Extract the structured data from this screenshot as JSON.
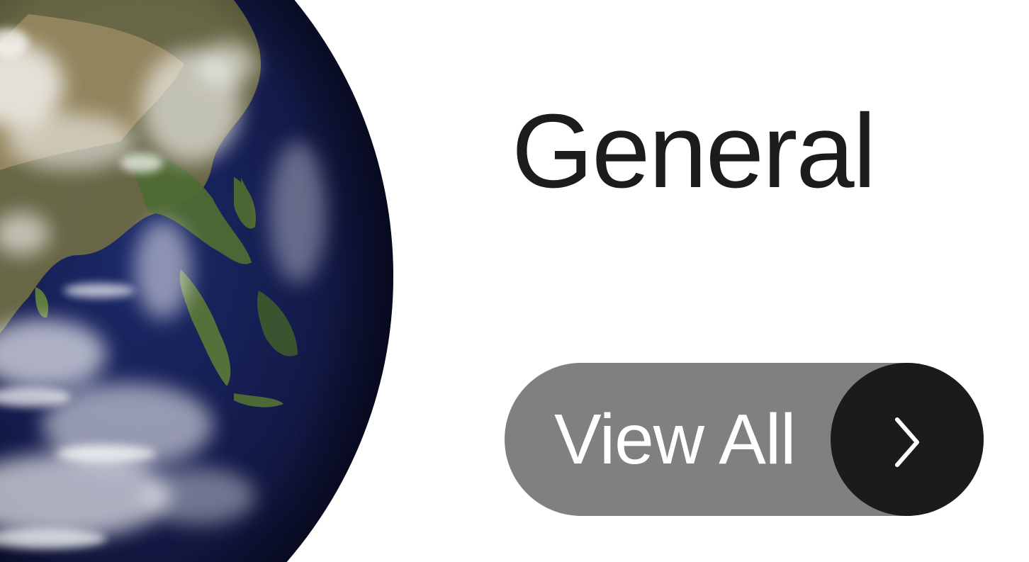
{
  "card": {
    "title": "General",
    "view_all_label": "View All",
    "image_subject": "earth-globe",
    "icons": {
      "arrow": "chevron-right-icon"
    }
  },
  "colors": {
    "background": "#ffffff",
    "title_text": "#1c1c1e",
    "button_background": "#808080",
    "button_text": "#ffffff",
    "arrow_circle": "#1b1b1b",
    "arrow_glyph": "#ffffff"
  }
}
